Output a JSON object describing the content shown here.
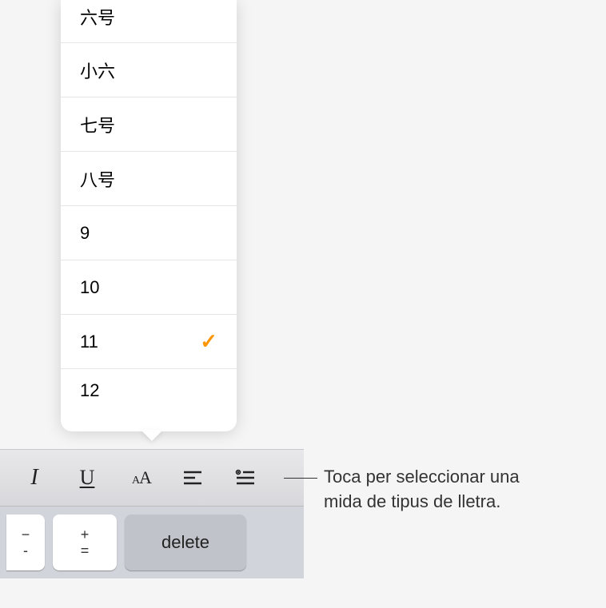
{
  "fontSizes": {
    "items": [
      {
        "label": "六号",
        "selected": false
      },
      {
        "label": "小六",
        "selected": false
      },
      {
        "label": "七号",
        "selected": false
      },
      {
        "label": "八号",
        "selected": false
      },
      {
        "label": "9",
        "selected": false
      },
      {
        "label": "10",
        "selected": false
      },
      {
        "label": "11",
        "selected": true
      },
      {
        "label": "12",
        "selected": false
      }
    ]
  },
  "toolbar": {
    "italic": "I",
    "underline": "U"
  },
  "keyboard": {
    "minus": "−",
    "underscore": "-",
    "plus": "+",
    "equals": "=",
    "delete": "delete"
  },
  "callout": {
    "line1": "Toca per seleccionar una",
    "line2": "mida de tipus de lletra."
  }
}
